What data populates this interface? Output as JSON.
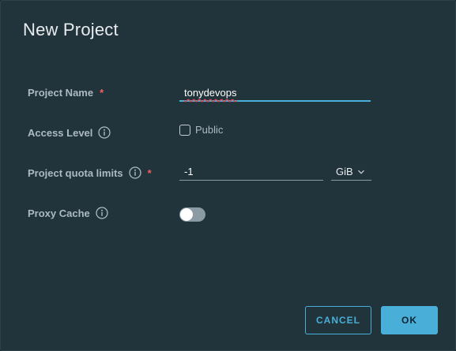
{
  "dialog": {
    "title": "New Project"
  },
  "form": {
    "project_name": {
      "label": "Project Name",
      "required_mark": "*",
      "value": "tonydevops"
    },
    "access_level": {
      "label": "Access Level",
      "checkbox_label": "Public",
      "checked": false
    },
    "quota": {
      "label": "Project quota limits",
      "required_mark": "*",
      "value": "-1",
      "unit": "GiB"
    },
    "proxy_cache": {
      "label": "Proxy Cache",
      "enabled": false
    }
  },
  "buttons": {
    "cancel": "CANCEL",
    "ok": "OK"
  },
  "colors": {
    "accent": "#49afd9",
    "required": "#f35e5e",
    "dialog_bg": "#21333b"
  },
  "icons": {
    "info": "info-circle-icon",
    "dropdown": "chevron-down-icon"
  }
}
